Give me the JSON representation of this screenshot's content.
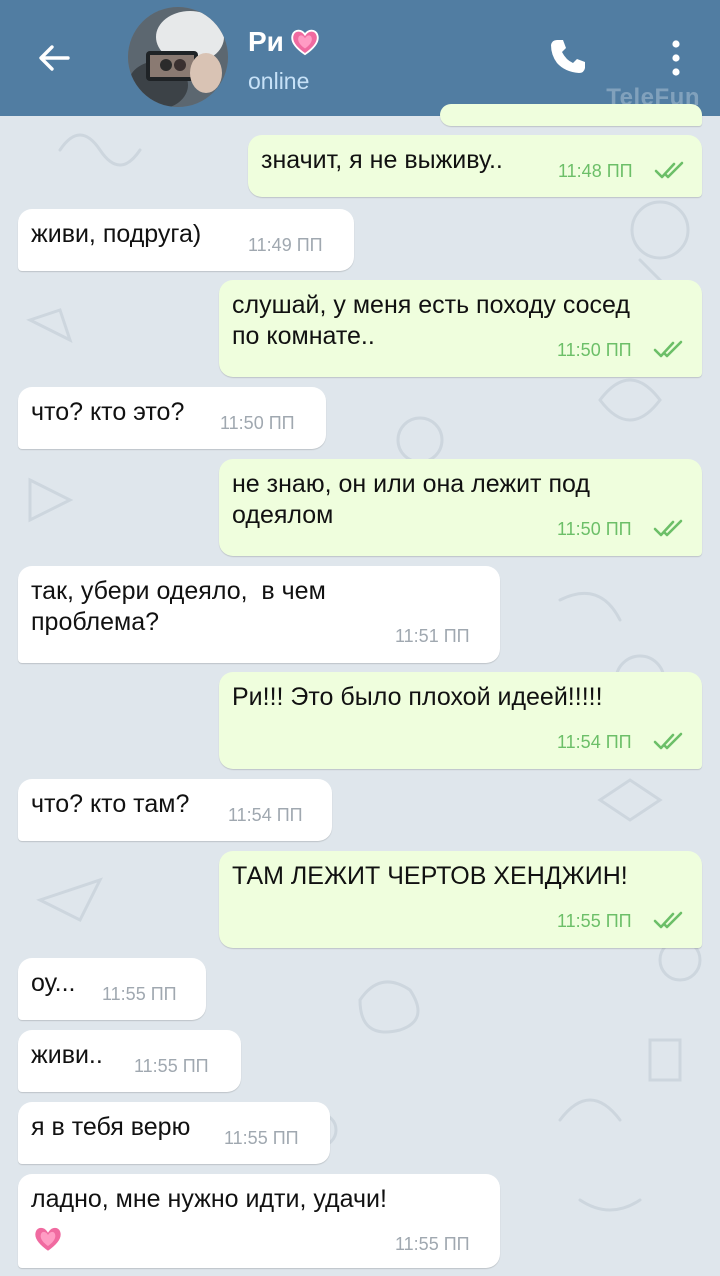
{
  "header": {
    "title": "Ри",
    "status": "online",
    "watermark": "TeleFun"
  },
  "colors": {
    "header": "#517da2",
    "incoming_bubble": "#ffffff",
    "outgoing_bubble": "#effedd",
    "outgoing_time": "#6cbf68",
    "incoming_time": "#a0a8b0",
    "heart": "#f06aa0"
  },
  "messages": [
    {
      "direction": "out",
      "text": "значит, я не выживу..",
      "time": "11:48 ПП",
      "read": true
    },
    {
      "direction": "in",
      "text": "живи, подруга)",
      "time": "11:49 ПП"
    },
    {
      "direction": "out",
      "text": "слушай, у меня есть походу сосед\nпо комнате..",
      "time": "11:50 ПП",
      "read": true
    },
    {
      "direction": "in",
      "text": "что? кто это?",
      "time": "11:50 ПП"
    },
    {
      "direction": "out",
      "text": "не знаю, он или она лежит под\nодеялом",
      "time": "11:50 ПП",
      "read": true
    },
    {
      "direction": "in",
      "text": "так, убери одеяло,  в чем\nпроблема?",
      "time": "11:51 ПП"
    },
    {
      "direction": "out",
      "text": "Ри!!! Это было плохой идеей!!!!!",
      "time": "11:54 ПП",
      "read": true
    },
    {
      "direction": "in",
      "text": "что? кто там?",
      "time": "11:54 ПП"
    },
    {
      "direction": "out",
      "text": "ТАМ ЛЕЖИТ ЧЕРТОВ ХЕНДЖИН!",
      "time": "11:55 ПП",
      "read": true
    },
    {
      "direction": "in",
      "text": "оу...",
      "time": "11:55 ПП"
    },
    {
      "direction": "in",
      "text": "живи..",
      "time": "11:55 ПП"
    },
    {
      "direction": "in",
      "text": "я в тебя верю",
      "time": "11:55 ПП"
    },
    {
      "direction": "in",
      "text": "ладно, мне нужно идти, удачи!",
      "time": "11:55 ПП",
      "emoji": "heart"
    }
  ]
}
